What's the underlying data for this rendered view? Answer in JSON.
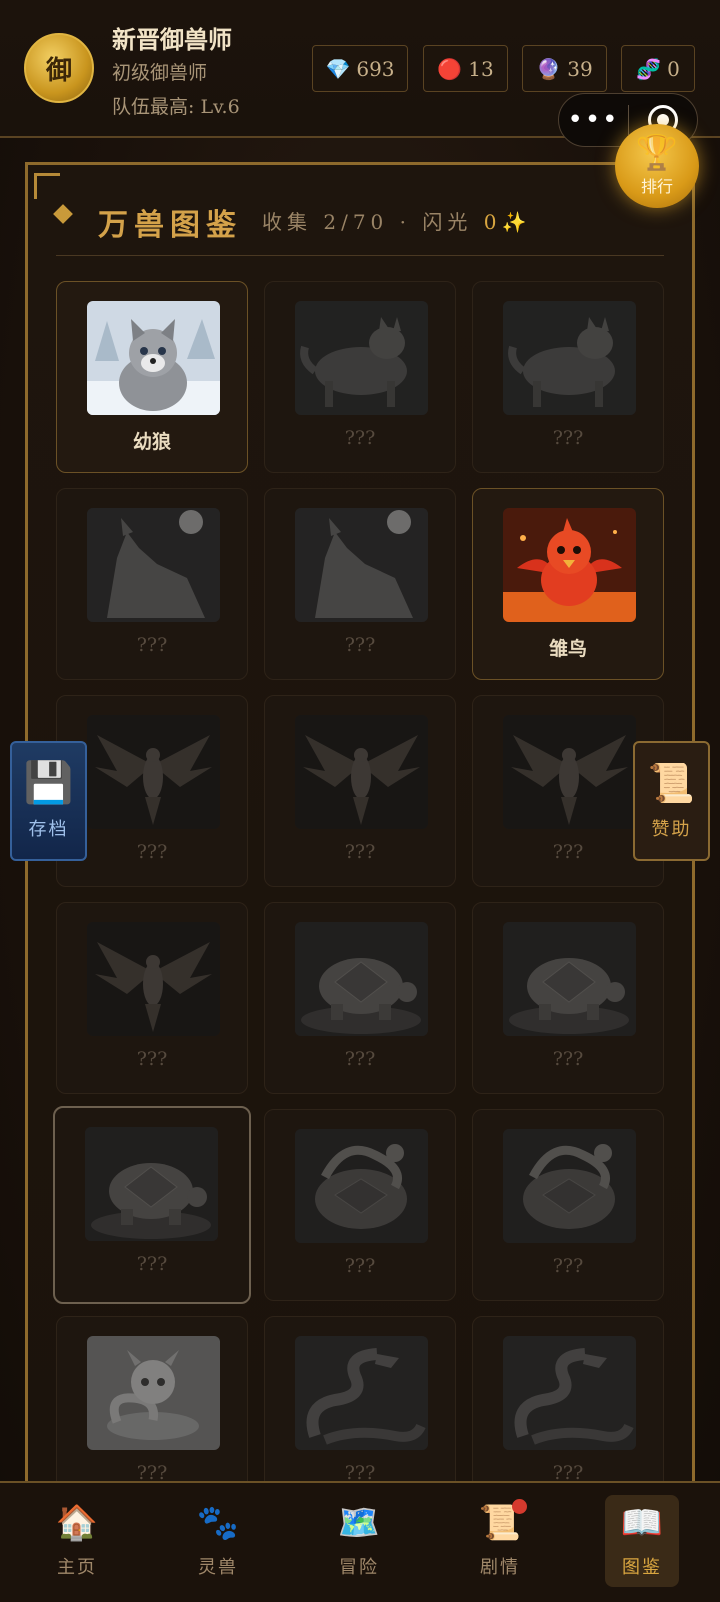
{
  "player": {
    "avatar_char": "御",
    "name": "新晋御兽师",
    "rank": "初级御兽师",
    "team_best": "队伍最高: Lv.6"
  },
  "resources": [
    {
      "icon": "💎",
      "icon_name": "diamond-icon",
      "value": "693"
    },
    {
      "icon": "🔴",
      "icon_name": "red-orb-icon",
      "value": "13"
    },
    {
      "icon": "🔮",
      "icon_name": "crystal-ball-icon",
      "value": "39"
    },
    {
      "icon": "🧬",
      "icon_name": "dna-icon",
      "value": "0"
    }
  ],
  "capsule": {
    "more": "•••"
  },
  "ranking": {
    "icon": "🏆",
    "label": "排行"
  },
  "codex": {
    "title": "万兽图鉴",
    "collect_label": "收集 2/70 · 闪光",
    "shiny_count": "0",
    "shiny_icon": "✨"
  },
  "cards": [
    {
      "name": "幼狼",
      "owned": true,
      "art": "wolf-cub"
    },
    {
      "name": "???",
      "owned": false,
      "art": "wolf"
    },
    {
      "name": "???",
      "owned": false,
      "art": "wolf"
    },
    {
      "name": "???",
      "owned": false,
      "art": "wolf-moon"
    },
    {
      "name": "???",
      "owned": false,
      "art": "wolf-moon"
    },
    {
      "name": "雏鸟",
      "owned": true,
      "art": "fire-chick"
    },
    {
      "name": "???",
      "owned": false,
      "art": "phoenix"
    },
    {
      "name": "???",
      "owned": false,
      "art": "phoenix"
    },
    {
      "name": "???",
      "owned": false,
      "art": "phoenix"
    },
    {
      "name": "???",
      "owned": false,
      "art": "phoenix"
    },
    {
      "name": "???",
      "owned": false,
      "art": "turtle"
    },
    {
      "name": "???",
      "owned": false,
      "art": "turtle"
    },
    {
      "name": "???",
      "owned": false,
      "art": "turtle"
    },
    {
      "name": "???",
      "owned": false,
      "art": "turtle-snake"
    },
    {
      "name": "???",
      "owned": false,
      "art": "turtle-snake"
    },
    {
      "name": "???",
      "owned": false,
      "art": "dragon-baby"
    },
    {
      "name": "???",
      "owned": false,
      "art": "dragon"
    },
    {
      "name": "???",
      "owned": false,
      "art": "dragon"
    }
  ],
  "side": {
    "save": {
      "icon": "💾",
      "label": "存档"
    },
    "sponsor": {
      "icon": "📜",
      "label": "赞助"
    }
  },
  "nav": [
    {
      "icon": "🏠",
      "icon_name": "home-icon",
      "label": "主页"
    },
    {
      "icon": "🐾",
      "icon_name": "paw-icon",
      "label": "灵兽"
    },
    {
      "icon": "🗺️",
      "icon_name": "map-icon",
      "label": "冒险"
    },
    {
      "icon": "📜",
      "icon_name": "scroll-icon",
      "label": "剧情",
      "badge": true
    },
    {
      "icon": "📖",
      "icon_name": "book-icon",
      "label": "图鉴",
      "active": true
    }
  ],
  "colors": {
    "accent": "#d4a24a",
    "background": "#1a120c",
    "save_blue": "#1f3b63",
    "badge_red": "#d53a2e"
  }
}
